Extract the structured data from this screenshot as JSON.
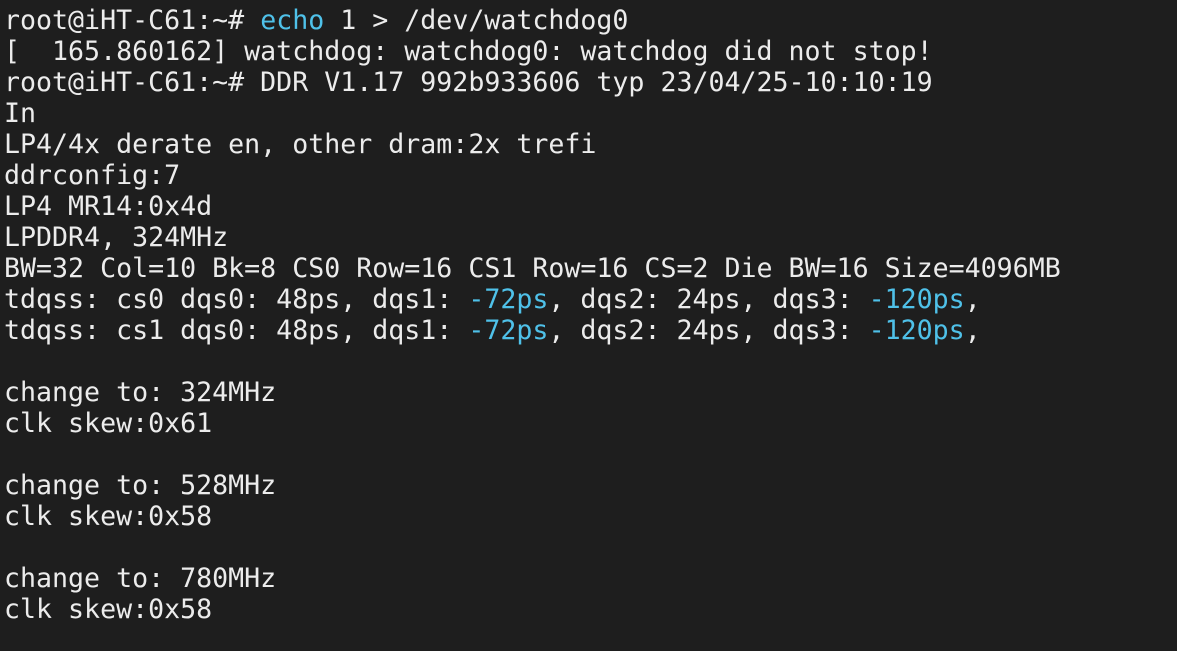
{
  "terminal": {
    "colors": {
      "background": "#1e1e1e",
      "foreground": "#ececec",
      "highlight": "#4fc1e9"
    },
    "lines": [
      [
        {
          "t": "root@iHT-C61:~# "
        },
        {
          "t": "echo",
          "hl": true
        },
        {
          "t": " 1 > /dev/watchdog0"
        }
      ],
      [
        {
          "t": "[  165.860162] watchdog: watchdog0: watchdog did not stop!"
        }
      ],
      [
        {
          "t": "root@iHT-C61:~# DDR V1.17 992b933606 typ 23/04/25-10:10:19"
        }
      ],
      [
        {
          "t": "In"
        }
      ],
      [
        {
          "t": "LP4/4x derate en, other dram:2x trefi"
        }
      ],
      [
        {
          "t": "ddrconfig:7"
        }
      ],
      [
        {
          "t": "LP4 MR14:0x4d"
        }
      ],
      [
        {
          "t": "LPDDR4, 324MHz"
        }
      ],
      [
        {
          "t": "BW=32 Col=10 Bk=8 CS0 Row=16 CS1 Row=16 CS=2 Die BW=16 Size=4096MB"
        }
      ],
      [
        {
          "t": "tdqss: cs0 dqs0: 48ps, dqs1: "
        },
        {
          "t": "-72ps",
          "hl": true
        },
        {
          "t": ", dqs2: 24ps, dqs3: "
        },
        {
          "t": "-120ps",
          "hl": true
        },
        {
          "t": ","
        }
      ],
      [
        {
          "t": "tdqss: cs1 dqs0: 48ps, dqs1: "
        },
        {
          "t": "-72ps",
          "hl": true
        },
        {
          "t": ", dqs2: 24ps, dqs3: "
        },
        {
          "t": "-120ps",
          "hl": true
        },
        {
          "t": ","
        }
      ],
      [
        {
          "t": ""
        }
      ],
      [
        {
          "t": "change to: 324MHz"
        }
      ],
      [
        {
          "t": "clk skew:0x61"
        }
      ],
      [
        {
          "t": ""
        }
      ],
      [
        {
          "t": "change to: 528MHz"
        }
      ],
      [
        {
          "t": "clk skew:0x58"
        }
      ],
      [
        {
          "t": ""
        }
      ],
      [
        {
          "t": "change to: 780MHz"
        }
      ],
      [
        {
          "t": "clk skew:0x58"
        }
      ]
    ]
  }
}
